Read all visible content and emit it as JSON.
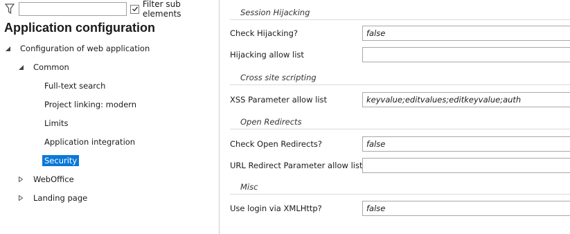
{
  "filter": {
    "value": "",
    "checkbox_label": "Filter sub elements",
    "checked": true
  },
  "title": "Application configuration",
  "tree": [
    {
      "label": "Configuration of web application",
      "toggle": "expanded"
    },
    {
      "label": "Common",
      "toggle": "expanded"
    },
    {
      "label": "Full-text search",
      "toggle": "none"
    },
    {
      "label": "Project linking: modern",
      "toggle": "none"
    },
    {
      "label": "Limits",
      "toggle": "none"
    },
    {
      "label": "Application integration",
      "toggle": "none"
    },
    {
      "label": "Security",
      "toggle": "none",
      "selected": true
    },
    {
      "label": "WebOffice",
      "toggle": "collapsed"
    },
    {
      "label": "Landing page",
      "toggle": "collapsed"
    }
  ],
  "sections": {
    "session_hijacking": "Session Hijacking",
    "xss": "Cross site scripting",
    "open_redirects": "Open Redirects",
    "misc": "Misc"
  },
  "fields": {
    "check_hijacking": {
      "label": "Check Hijacking?",
      "value": "false"
    },
    "hijacking_allow_list": {
      "label": "Hijacking allow list",
      "value": ""
    },
    "xss_allow_list": {
      "label": "XSS Parameter allow list",
      "value": "keyvalue;editvalues;editkeyvalue;auth"
    },
    "check_open_redirects": {
      "label": "Check Open Redirects?",
      "value": "false"
    },
    "url_redirect_allow_list": {
      "label": "URL Redirect Parameter allow list",
      "value": ""
    },
    "use_login_xmlhttp": {
      "label": "Use login via XMLHttp?",
      "value": "false"
    }
  },
  "colors": {
    "selection": "#0a78d7"
  }
}
